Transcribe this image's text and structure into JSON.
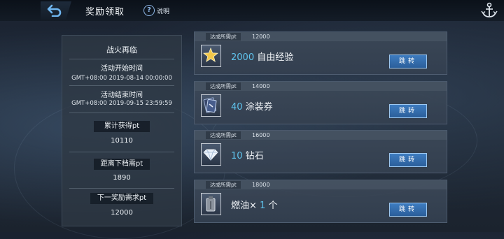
{
  "header": {
    "title": "奖励领取",
    "help_label": "说明"
  },
  "event": {
    "title": "战火再临",
    "start_label": "活动开始时间",
    "start_value": "GMT+08:00 2019-08-14 00:00:00",
    "end_label": "活动结束时间",
    "end_value": "GMT+08:00 2019-09-15 23:59:59",
    "earned_label": "累计获得pt",
    "earned_value": "10110",
    "next_tier_label": "距离下档需pt",
    "next_tier_value": "1890",
    "next_reward_label": "下一奖励需求pt",
    "next_reward_value": "12000"
  },
  "rewards": [
    {
      "req_label": "达成所需pt",
      "req_value": "12000",
      "qty": "2000",
      "name": " 自由经验",
      "icon": "gold-star-icon",
      "button": "跳转"
    },
    {
      "req_label": "达成所需pt",
      "req_value": "14000",
      "qty": "40",
      "name": " 涂装券",
      "icon": "paint-coupon-icon",
      "button": "跳转"
    },
    {
      "req_label": "达成所需pt",
      "req_value": "16000",
      "qty": "10",
      "name": " 钻石",
      "icon": "diamond-icon",
      "button": "跳转"
    },
    {
      "req_label": "达成所需pt",
      "req_value": "18000",
      "prefix": "燃油× ",
      "qty": "1",
      "name": " 个",
      "icon": "fuel-can-icon",
      "button": "跳转"
    }
  ],
  "colors": {
    "accent_blue": "#5fc4ee",
    "button_blue": "#3e7cc0"
  }
}
